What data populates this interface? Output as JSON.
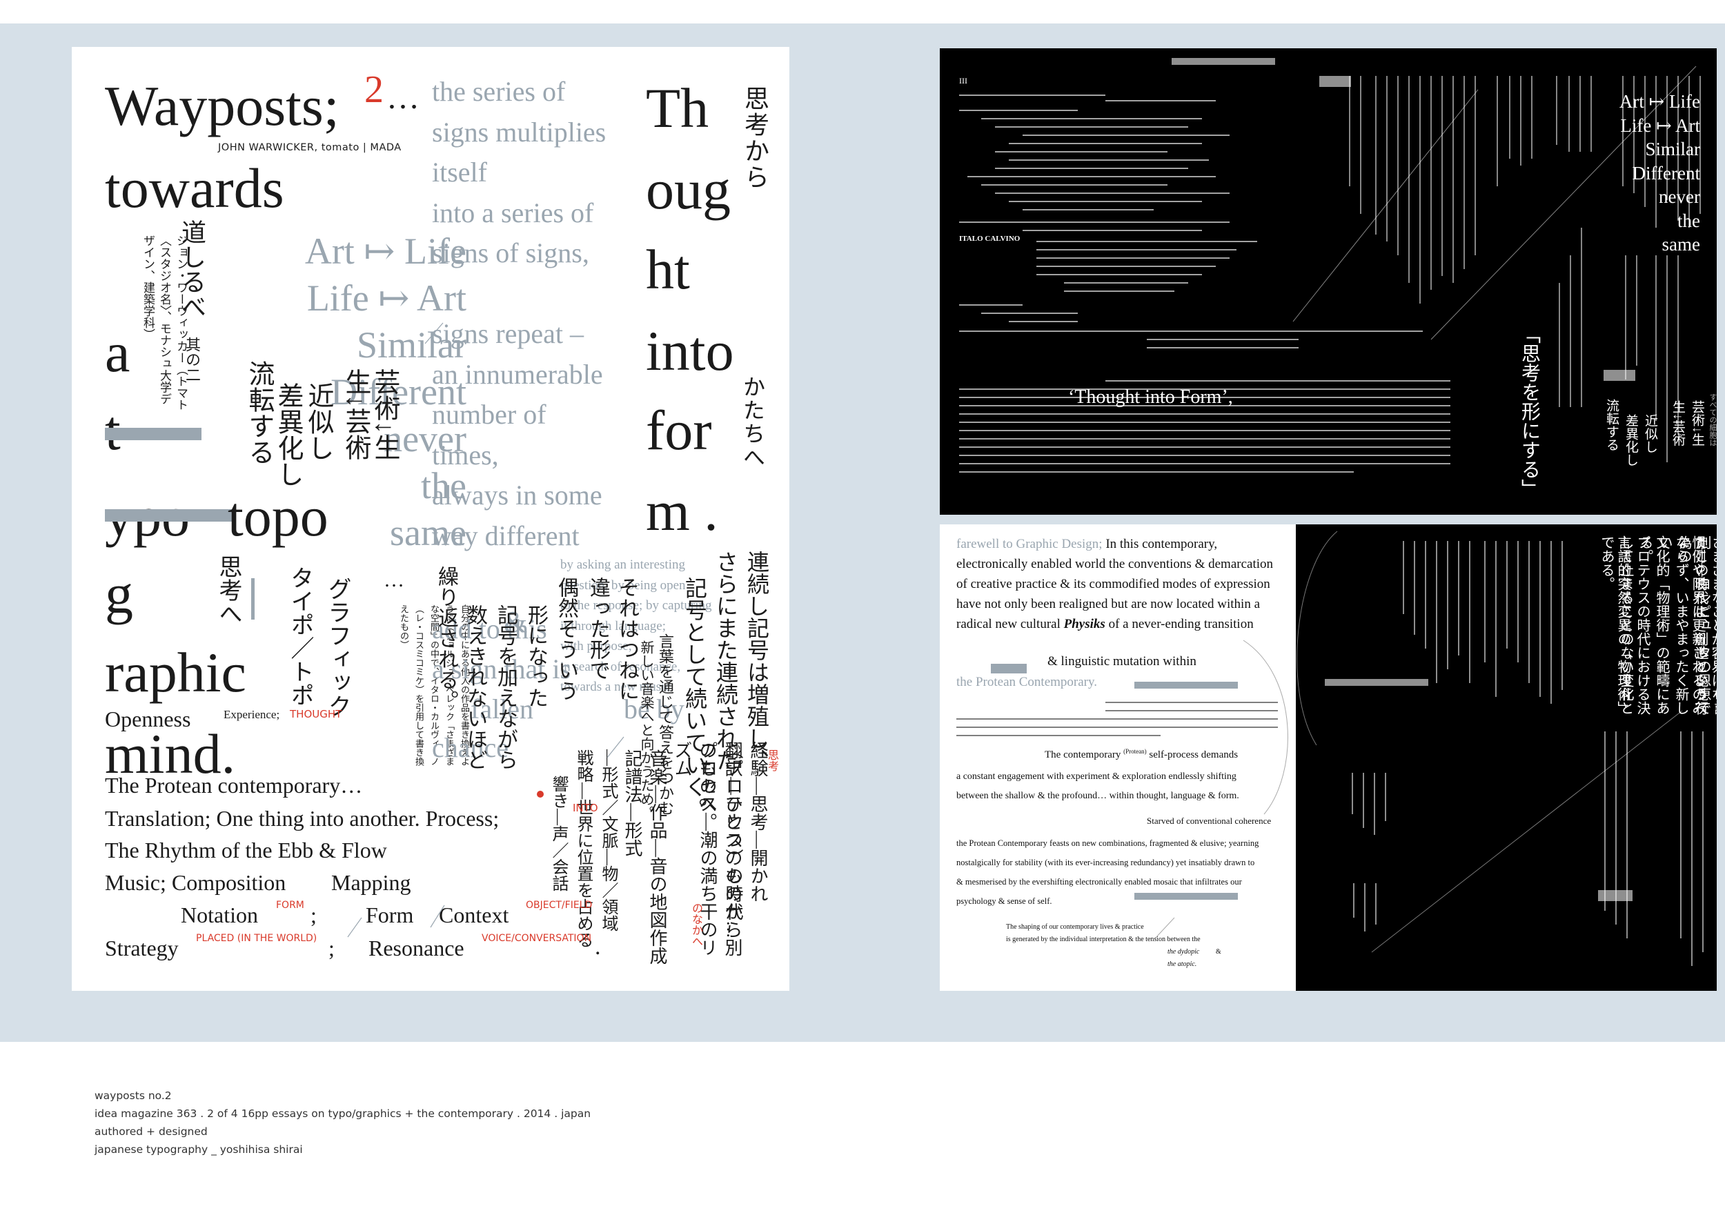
{
  "poster": {
    "title_lines": [
      "Wayposts;",
      "towards",
      "a",
      "t",
      "ypo",
      "g",
      "raphic",
      "mind."
    ],
    "title_number": "2",
    "title_ellipsis": "…",
    "byline": "JOHN WARWICKER, tomato | MADA",
    "grey_column": "the series of\nsigns multiplies\nitself\ninto a series of\nsigns of signs,\n\nsigns repeat –\nan innumerable\nnumber of\ntimes,\nalways in some\nway different",
    "art_life": [
      "Art ↦ Life",
      "Life ↦ Art",
      "Similar",
      "Different",
      "never",
      "the",
      "same"
    ],
    "mid_grey_text": "by asking an interesting\nquestion, by being open\nto the response; by capturing\nit through language;\nwith purpose;\nin search of resonance,\ntowards a new music.",
    "add_lines": [
      "add to this",
      "a sign that is",
      "fallen",
      "chance"
    ],
    "add_fragments": [
      "&",
      "be by"
    ],
    "right_thought": [
      "Th",
      "oug",
      "ht",
      "into",
      "for",
      "m ."
    ],
    "openness": "Openness",
    "experience": "Experience;",
    "experience_red": "THOUGHT",
    "dots": "…",
    "list": {
      "protean": "The Protean contemporary…",
      "translation": "Translation; One thing into another. Process;",
      "rhythm": "The Rhythm of the Ebb & Flow",
      "music": "Music; Composition",
      "mapping": "Mapping",
      "notation": "Notation",
      "notation_red": "FORM",
      "form": "Form",
      "context": "Context",
      "context_red": "OBJECT/FIELD",
      "strategy": "Strategy",
      "strategy_red": "PLACED (IN THE WORLD)",
      "resonance": "Resonance",
      "resonance_red": "VOICE/CONVERSATION",
      "into_red": "INTO",
      "semicolon": ";"
    },
    "jp": {
      "title_v": "道しるべ",
      "title_small": "其の二",
      "author_v": "ジョン・ワーウィッカー（トマト〈スタジオ名〉、モナシュ大学デザイン、建築学科）",
      "col_a": "芸術↓生",
      "col_b": "生↓芸術",
      "col_c": "近似し",
      "col_d": "差異化し",
      "col_e": "流転する",
      "top_right_1": "思考から",
      "top_right_2": "かたちへ",
      "typo_v": "タイポ／トポ",
      "graphic_v": "グラフィック",
      "shikou_v": "思考へ",
      "quote_v": "自分の中にある他人の作品を書き換えように（ジョルジュ・ペレック「さまざまな空間」の中で、イタロ・カルヴィーノ（レ・コスミコミケ）を引用して書き換えたもの）",
      "col_1": "連続し記号は増殖し、",
      "col_2": "さらにまた連続された",
      "col_3": "記号として続いていく。",
      "col_4": "それはつねに",
      "col_5": "違った形で",
      "col_6": "偶然そういう",
      "col_7": "形になった",
      "col_8": "記号を加えながら",
      "col_9": "数えきれないほど",
      "col_10": "繰り返される。",
      "col_11": "言葉を通じて答えをつかむ",
      "col_12": "新しい音楽へと向かうため。",
      "exp_1": "経験―思考―開かれ",
      "exp_2": "（プロテウス）の時代…",
      "exp_3": "翻訳―ひとつのものから別のものへ。",
      "exp_4": "プロセス―潮の満ち干のリズム",
      "exp_5": "音楽―作品―音の地図作成",
      "exp_6": "記譜法―形式",
      "exp_7": "―形式／文脈―物／領域",
      "exp_8": "戦略―世界に位置を占める",
      "exp_9": "響き―声／会話",
      "exp_red_1": "思考",
      "exp_red_2": "のなかへ"
    }
  },
  "spread_top": {
    "roman": "III",
    "art_life": [
      "Art ↦ Life",
      "Life ↦ Art",
      "Similar",
      "Different",
      "never",
      "the",
      "same"
    ],
    "thought_into_form": "‘Thought into Form’,",
    "author_credit": "ITALO CALVINO",
    "jp_bracket": "「思考を形にする」",
    "jp_cols": [
      "芸術↓生",
      "生↓芸術",
      "近似し",
      "差異化し",
      "流転する",
      "すべての細胞は"
    ]
  },
  "spread_bottom_left": {
    "lead_grey": "farewell to Graphic Design;",
    "lead_black": "In this contemporary, electronically enabled world the conventions & demarcation of creative practice & its commodified modes of expression have not only been realigned but are now located within a radical new cultural",
    "physiks": "Physiks",
    "lead_tail": "of a never-ending transition",
    "lead_tail2": "& linguistic mutation within",
    "lead_grey_end": "the Protean Contemporary.",
    "protean_self": "The contemporary",
    "protean_label": "(Protean)",
    "protean_self_tail": "self-process demands",
    "body_small": "a constant engagement with experiment & exploration endlessly shifting between the shallow & the profound… within thought, language & form.",
    "starved": "Starved of conventional coherence",
    "feasts": "the Protean Contemporary feasts on new combinations, fragmented & elusive; yearning nostalgically for stability (with its ever-increasing redundancy) yet insatiably drawn to & mesmerised by the evershifting electronically enabled mosaic that infiltrates our psychology & sense of self.",
    "shaping": "The shaping of our contemporary lives & practice",
    "shaping2": "is generated by the individual interpretation & the tension between the",
    "dydopic": "the dydopic",
    "atopic": "the atopic.",
    "amp": "&"
  },
  "spread_bottom_right": {
    "jp_cols": [
      "グラフィックデザインとの訣別――コンピュータの恩恵で",
      "さまざまなことが容易になったこの時代に、創造という行為の",
      "慣例や限界は更新されるのみならず、いまやまったく新しい",
      "文化的「物理術」の範疇にある。",
      "プロテウスの時代における決して止まることのない変化と",
      "言語的突然変異の「物理術」である。"
    ]
  },
  "caption": {
    "line1": "wayposts no.2",
    "line2": "idea magazine 363 . 2 of 4 16pp essays on typo/graphics + the contemporary . 2014 . japan",
    "line3": "authored + designed",
    "line4": "japanese typography _ yoshihisa shirai"
  },
  "colors": {
    "band": "#d6e0e8",
    "grey_text": "#9aa6b0",
    "red": "#d93a2b",
    "black_panel": "#000000"
  }
}
